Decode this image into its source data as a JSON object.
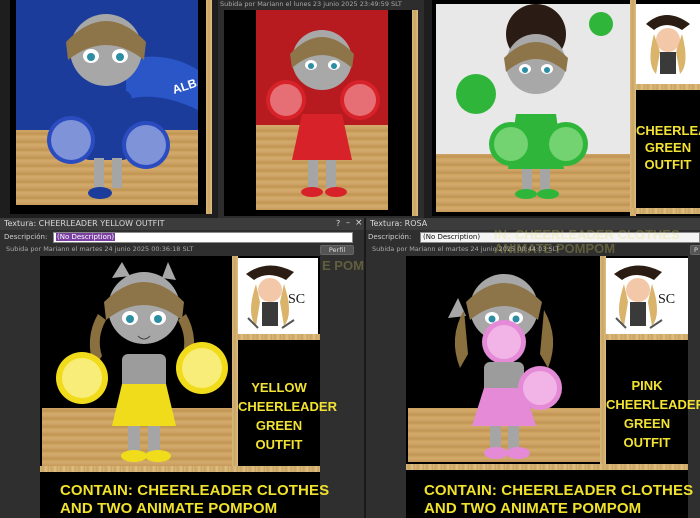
{
  "top_strip": {
    "uploaded_label": "Subida por Mariann el lunes 23 junio 2025 23:49:59 SLT",
    "green_outfit_lines": [
      "CHEERLEADER",
      "GREEN OUTFIT"
    ]
  },
  "window_left": {
    "title": "Textura: CHEERLEADER YELLOW OUTFIT",
    "help_glyph": "?",
    "minimize_glyph": "–",
    "close_glyph": "×",
    "desc_label": "Descripción:",
    "desc_value": "(No Description)",
    "uploaded_label": "Subida por Mariann el martes 24 junio 2025 00:36:18 SLT",
    "profile_button": "Perfil",
    "sign_lines": [
      "YELLOW",
      "CHEERLEADER",
      "GREEN OUTFIT"
    ],
    "logo_text": "SC",
    "bottom_lines": [
      "CONTAIN: CHEERLEADER CLOTHES",
      "AND TWO ANIMATE POMPOM"
    ],
    "ghost_text": "E POM",
    "outfit_color": "#f1dc1c"
  },
  "window_right": {
    "title": "Textura: ROSA",
    "desc_label": "Descripción:",
    "desc_value": "(No Description)",
    "uploaded_label": "Subida por Mariann el martes 24 junio 2025 00:44:03 SLT",
    "profile_button": "P",
    "sign_lines": [
      "PINK",
      "CHEERLEADER",
      "GREEN OUTFIT"
    ],
    "logo_text": "SC",
    "bottom_lines": [
      "CONTAIN: CHEERLEADER CLOTHES",
      "AND TWO ANIMATE POMPOM"
    ],
    "ghost_lines": [
      "IN: CHEERLEADER CLOTHES",
      "ANIMATE POMPOM"
    ],
    "outfit_color": "#e48ad6"
  },
  "colors": {
    "blue": "#1c3c9c",
    "red": "#d8222a",
    "green": "#2fb63a",
    "yellow_text": "#f0e22c",
    "frame": "#d8b86a"
  }
}
